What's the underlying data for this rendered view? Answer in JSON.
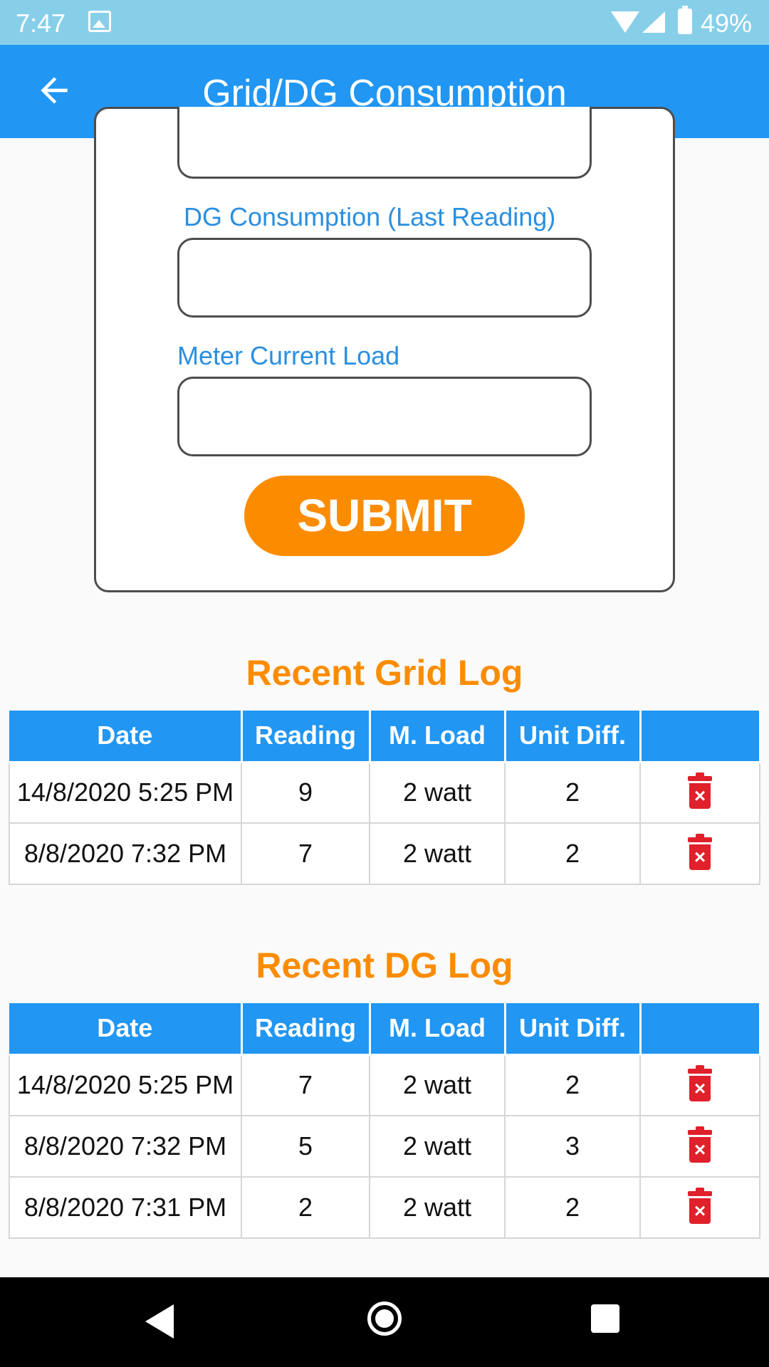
{
  "status_bar": {
    "time": "7:47",
    "battery": "49%"
  },
  "app_bar": {
    "title": "Grid/DG Consumption"
  },
  "form": {
    "field_top_value": "",
    "dg_label": "DG Consumption (Last Reading)",
    "dg_value": "",
    "load_label": "Meter Current Load",
    "load_value": "",
    "submit_label": "SUBMIT"
  },
  "grid_log": {
    "title": "Recent Grid Log",
    "headers": [
      "Date",
      "Reading",
      "M. Load",
      "Unit Diff.",
      ""
    ],
    "rows": [
      [
        "14/8/2020 5:25 PM",
        "9",
        "2 watt",
        "2"
      ],
      [
        "8/8/2020 7:32 PM",
        "7",
        "2 watt",
        "2"
      ]
    ]
  },
  "dg_log": {
    "title": "Recent DG Log",
    "headers": [
      "Date",
      "Reading",
      "M. Load",
      "Unit Diff.",
      ""
    ],
    "rows": [
      [
        "14/8/2020 5:25 PM",
        "7",
        "2 watt",
        "2"
      ],
      [
        "8/8/2020 7:32 PM",
        "5",
        "2 watt",
        "3"
      ],
      [
        "8/8/2020 7:31 PM",
        "2",
        "2 watt",
        "2"
      ]
    ]
  },
  "colors": {
    "app_bar": "#2196f3",
    "status_bar": "#87cfe9",
    "accent": "#fb8c00",
    "delete": "#e0202a",
    "label": "#2b8fe0"
  }
}
